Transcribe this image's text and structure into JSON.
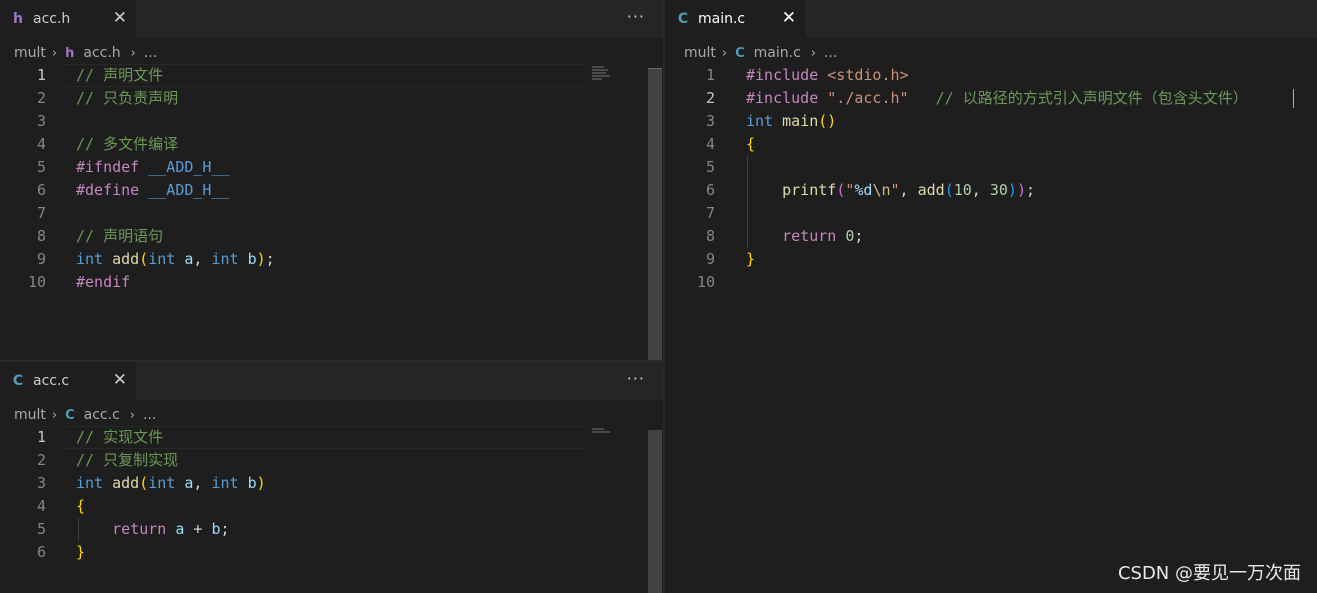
{
  "tabs": {
    "acc_h": {
      "label": "acc.h",
      "lang_glyph": "h"
    },
    "acc_c": {
      "label": "acc.c",
      "lang_glyph": "C"
    },
    "main_c": {
      "label": "main.c",
      "lang_glyph": "C"
    },
    "close_glyph": "✕",
    "more_glyph": "···"
  },
  "breadcrumbs": {
    "folder": "mult",
    "separator": "›",
    "ellipsis": "...",
    "acc_h": "acc.h",
    "acc_c": "acc.c",
    "main_c": "main.c"
  },
  "files": {
    "acc_h": {
      "line_numbers": [
        "1",
        "2",
        "3",
        "4",
        "5",
        "6",
        "7",
        "8",
        "9",
        "10"
      ],
      "active_line": 1,
      "lines": [
        [
          {
            "t": "// 声明文件",
            "c": "cm"
          }
        ],
        [
          {
            "t": "// 只负责声明",
            "c": "cm"
          }
        ],
        [],
        [
          {
            "t": "// 多文件编译",
            "c": "cm"
          }
        ],
        [
          {
            "t": "#ifndef ",
            "c": "pp"
          },
          {
            "t": "__ADD_H__",
            "c": "mac"
          }
        ],
        [
          {
            "t": "#define ",
            "c": "pp"
          },
          {
            "t": "__ADD_H__",
            "c": "mac"
          }
        ],
        [],
        [
          {
            "t": "// 声明语句",
            "c": "cm"
          }
        ],
        [
          {
            "t": "int",
            "c": "kw"
          },
          {
            "t": " ",
            "c": "pl"
          },
          {
            "t": "add",
            "c": "fn"
          },
          {
            "t": "(",
            "c": "br1"
          },
          {
            "t": "int",
            "c": "kw"
          },
          {
            "t": " ",
            "c": "pl"
          },
          {
            "t": "a",
            "c": "var"
          },
          {
            "t": ", ",
            "c": "pl"
          },
          {
            "t": "int",
            "c": "kw"
          },
          {
            "t": " ",
            "c": "pl"
          },
          {
            "t": "b",
            "c": "var"
          },
          {
            "t": ")",
            "c": "br1"
          },
          {
            "t": ";",
            "c": "pl"
          }
        ],
        [
          {
            "t": "#endif",
            "c": "pp"
          }
        ]
      ]
    },
    "acc_c": {
      "line_numbers": [
        "1",
        "2",
        "3",
        "4",
        "5",
        "6"
      ],
      "active_line": 1,
      "lines": [
        [
          {
            "t": "// 实现文件",
            "c": "cm"
          }
        ],
        [
          {
            "t": "// 只复制实现",
            "c": "cm"
          }
        ],
        [
          {
            "t": "int",
            "c": "kw"
          },
          {
            "t": " ",
            "c": "pl"
          },
          {
            "t": "add",
            "c": "fn"
          },
          {
            "t": "(",
            "c": "br1"
          },
          {
            "t": "int",
            "c": "kw"
          },
          {
            "t": " ",
            "c": "pl"
          },
          {
            "t": "a",
            "c": "var"
          },
          {
            "t": ", ",
            "c": "pl"
          },
          {
            "t": "int",
            "c": "kw"
          },
          {
            "t": " ",
            "c": "pl"
          },
          {
            "t": "b",
            "c": "var"
          },
          {
            "t": ")",
            "c": "br1"
          }
        ],
        [
          {
            "t": "{",
            "c": "br1"
          }
        ],
        [
          {
            "t": "    ",
            "c": "pl"
          },
          {
            "t": "return",
            "c": "pp"
          },
          {
            "t": " ",
            "c": "pl"
          },
          {
            "t": "a",
            "c": "var"
          },
          {
            "t": " + ",
            "c": "pl"
          },
          {
            "t": "b",
            "c": "var"
          },
          {
            "t": ";",
            "c": "pl"
          }
        ],
        [
          {
            "t": "}",
            "c": "br1"
          }
        ]
      ]
    },
    "main_c": {
      "line_numbers": [
        "1",
        "2",
        "3",
        "4",
        "5",
        "6",
        "7",
        "8",
        "9",
        "10"
      ],
      "active_line": 2,
      "lines": [
        [
          {
            "t": "#include ",
            "c": "pp"
          },
          {
            "t": "<stdio.h>",
            "c": "str"
          }
        ],
        [
          {
            "t": "#include ",
            "c": "pp"
          },
          {
            "t": "\"./acc.h\"",
            "c": "str"
          },
          {
            "t": "   ",
            "c": "pl"
          },
          {
            "t": "// 以路径的方式引入声明文件（包含头文件）",
            "c": "cm"
          }
        ],
        [
          {
            "t": "int",
            "c": "kw"
          },
          {
            "t": " ",
            "c": "pl"
          },
          {
            "t": "main",
            "c": "fn"
          },
          {
            "t": "()",
            "c": "br1"
          }
        ],
        [
          {
            "t": "{",
            "c": "br1"
          }
        ],
        [],
        [
          {
            "t": "    ",
            "c": "pl"
          },
          {
            "t": "printf",
            "c": "fn"
          },
          {
            "t": "(",
            "c": "br2"
          },
          {
            "t": "\"",
            "c": "str"
          },
          {
            "t": "%d",
            "c": "var"
          },
          {
            "t": "\\n",
            "c": "esc"
          },
          {
            "t": "\"",
            "c": "str"
          },
          {
            "t": ", ",
            "c": "pl"
          },
          {
            "t": "add",
            "c": "fn"
          },
          {
            "t": "(",
            "c": "br3"
          },
          {
            "t": "10",
            "c": "num"
          },
          {
            "t": ", ",
            "c": "pl"
          },
          {
            "t": "30",
            "c": "num"
          },
          {
            "t": ")",
            "c": "br3"
          },
          {
            "t": ")",
            "c": "br2"
          },
          {
            "t": ";",
            "c": "pl"
          }
        ],
        [],
        [
          {
            "t": "    ",
            "c": "pl"
          },
          {
            "t": "return",
            "c": "pp"
          },
          {
            "t": " ",
            "c": "pl"
          },
          {
            "t": "0",
            "c": "num"
          },
          {
            "t": ";",
            "c": "pl"
          }
        ],
        [
          {
            "t": "}",
            "c": "br1"
          }
        ],
        []
      ]
    }
  },
  "watermark": "CSDN @要见一万次面",
  "colors": {
    "background": "#1e1e1e",
    "tabbar": "#252526",
    "comment": "#6a9955",
    "keyword": "#569cd6",
    "preprocessor": "#c586c0",
    "function": "#dcdcaa",
    "variable": "#9cdcfe",
    "string": "#ce9178",
    "number": "#b5cea8"
  }
}
